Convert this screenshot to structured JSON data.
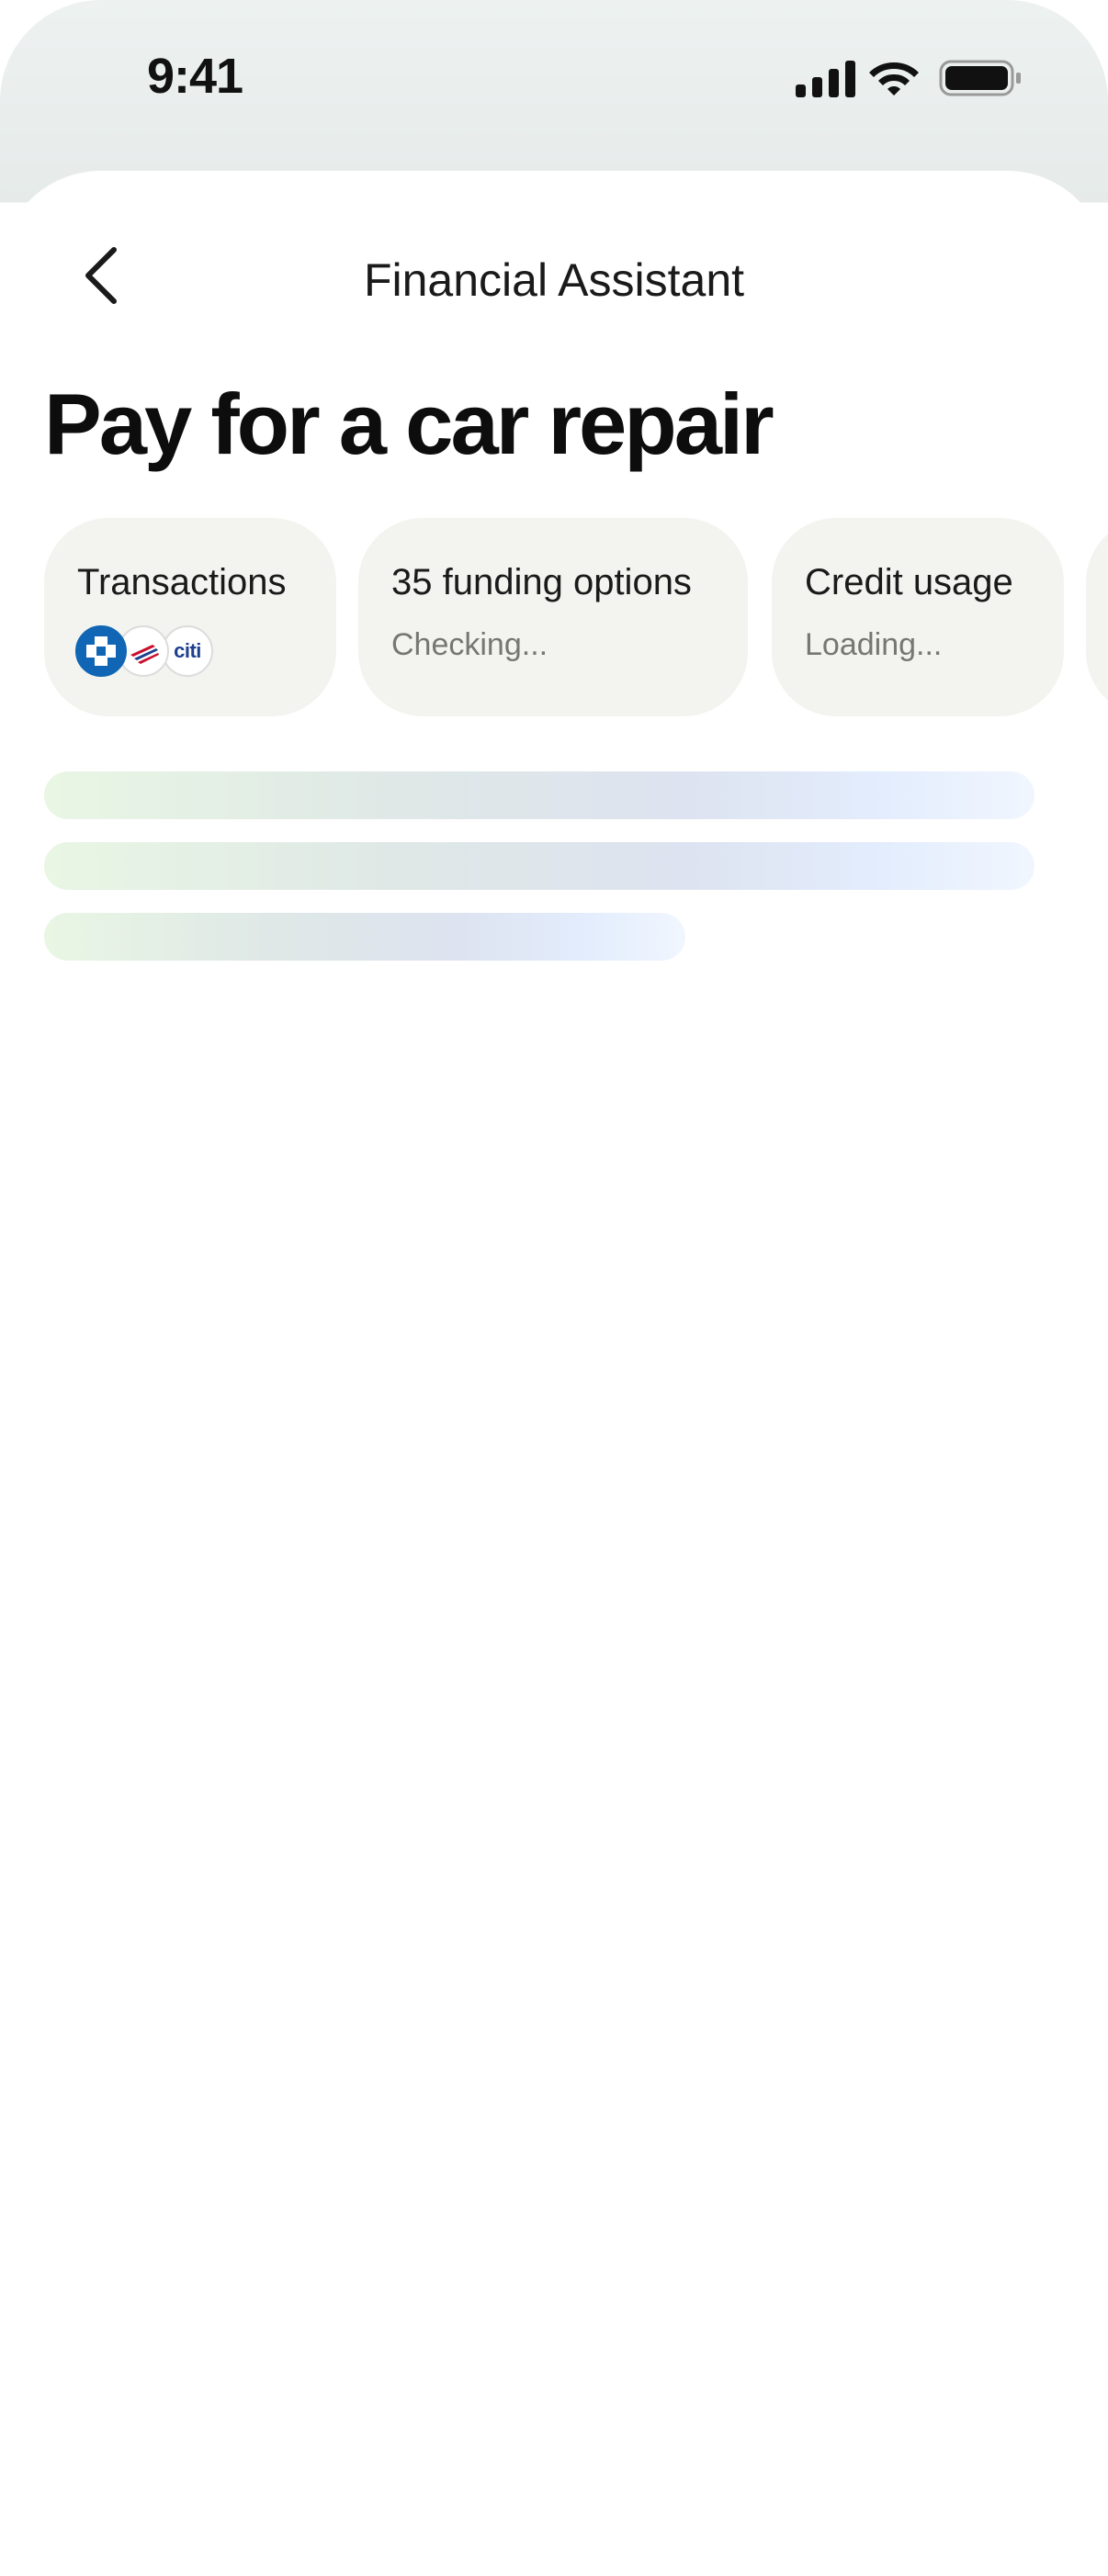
{
  "status_bar": {
    "time": "9:41",
    "icons": [
      "cellular-signal-icon",
      "wifi-icon",
      "battery-icon"
    ]
  },
  "nav": {
    "back_icon": "chevron-left-icon",
    "title": "Financial Assistant"
  },
  "page": {
    "title": "Pay for a car repair"
  },
  "chips": [
    {
      "title": "Transactions",
      "logos": [
        {
          "name": "chase-logo-icon",
          "color": "#1066b4"
        },
        {
          "name": "bank-of-america-logo-icon",
          "color": "#c8102e"
        },
        {
          "name": "citi-logo-icon",
          "color": "#1d3f8f",
          "text": "citi"
        }
      ]
    },
    {
      "title": "35 funding options",
      "subtitle": "Checking..."
    },
    {
      "title": "Credit usage",
      "subtitle": "Loading..."
    }
  ],
  "loading_state": {
    "skeleton_lines": 3
  },
  "colors": {
    "chip_background": "#f3f3ef",
    "subtitle_text": "#777772",
    "skeleton_start": "#e9f6e4",
    "skeleton_end": "#e3edfd"
  }
}
